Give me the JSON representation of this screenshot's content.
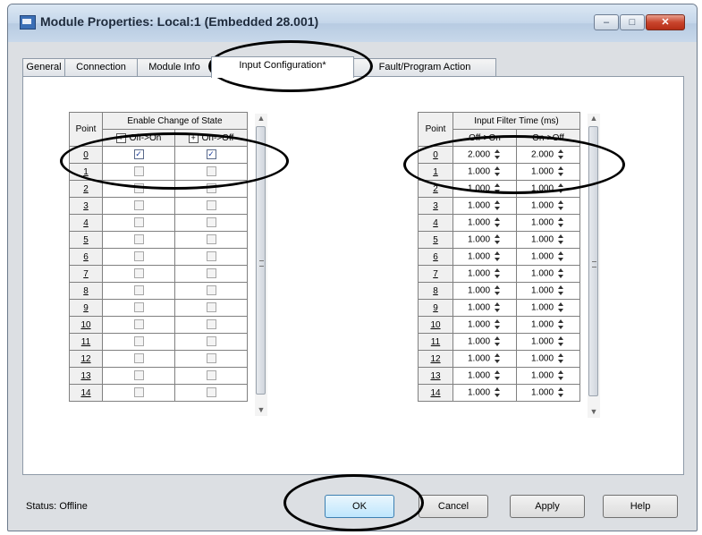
{
  "window": {
    "title": "Module Properties: Local:1 (Embedded 28.001)",
    "min_symbol": "–",
    "max_symbol": "□",
    "close_symbol": "✕"
  },
  "tabs": [
    {
      "label": "General"
    },
    {
      "label": "Connection"
    },
    {
      "label": "Module Info"
    },
    {
      "label": "Input Configuration*",
      "active": true
    },
    {
      "label": "Fault/Program Action"
    }
  ],
  "cos_table": {
    "point_header": "Point",
    "group_header": "Enable Change of State",
    "col1": "Off->On",
    "col2": "On->Off",
    "expand_symbol": "+",
    "rows": [
      {
        "point": "0",
        "off_on": true,
        "on_off": true
      },
      {
        "point": "1",
        "off_on": false,
        "on_off": false
      },
      {
        "point": "2",
        "off_on": false,
        "on_off": false
      },
      {
        "point": "3",
        "off_on": false,
        "on_off": false
      },
      {
        "point": "4",
        "off_on": false,
        "on_off": false
      },
      {
        "point": "5",
        "off_on": false,
        "on_off": false
      },
      {
        "point": "6",
        "off_on": false,
        "on_off": false
      },
      {
        "point": "7",
        "off_on": false,
        "on_off": false
      },
      {
        "point": "8",
        "off_on": false,
        "on_off": false
      },
      {
        "point": "9",
        "off_on": false,
        "on_off": false
      },
      {
        "point": "10",
        "off_on": false,
        "on_off": false
      },
      {
        "point": "11",
        "off_on": false,
        "on_off": false
      },
      {
        "point": "12",
        "off_on": false,
        "on_off": false
      },
      {
        "point": "13",
        "off_on": false,
        "on_off": false
      },
      {
        "point": "14",
        "off_on": false,
        "on_off": false
      }
    ]
  },
  "filter_table": {
    "point_header": "Point",
    "group_header": "Input Filter Time (ms)",
    "col1": "Off->On",
    "col2": "On->Off",
    "rows": [
      {
        "point": "0",
        "off_on": "2.000",
        "on_off": "2.000"
      },
      {
        "point": "1",
        "off_on": "1.000",
        "on_off": "1.000"
      },
      {
        "point": "2",
        "off_on": "1.000",
        "on_off": "1.000"
      },
      {
        "point": "3",
        "off_on": "1.000",
        "on_off": "1.000"
      },
      {
        "point": "4",
        "off_on": "1.000",
        "on_off": "1.000"
      },
      {
        "point": "5",
        "off_on": "1.000",
        "on_off": "1.000"
      },
      {
        "point": "6",
        "off_on": "1.000",
        "on_off": "1.000"
      },
      {
        "point": "7",
        "off_on": "1.000",
        "on_off": "1.000"
      },
      {
        "point": "8",
        "off_on": "1.000",
        "on_off": "1.000"
      },
      {
        "point": "9",
        "off_on": "1.000",
        "on_off": "1.000"
      },
      {
        "point": "10",
        "off_on": "1.000",
        "on_off": "1.000"
      },
      {
        "point": "11",
        "off_on": "1.000",
        "on_off": "1.000"
      },
      {
        "point": "12",
        "off_on": "1.000",
        "on_off": "1.000"
      },
      {
        "point": "13",
        "off_on": "1.000",
        "on_off": "1.000"
      },
      {
        "point": "14",
        "off_on": "1.000",
        "on_off": "1.000"
      }
    ]
  },
  "status": {
    "label": "Status:",
    "value": "Offline"
  },
  "buttons": {
    "ok": "OK",
    "cancel": "Cancel",
    "apply": "Apply",
    "help": "Help"
  },
  "scroll": {
    "up": "▲",
    "down": "▼"
  },
  "icons": {
    "checked": "✓"
  }
}
